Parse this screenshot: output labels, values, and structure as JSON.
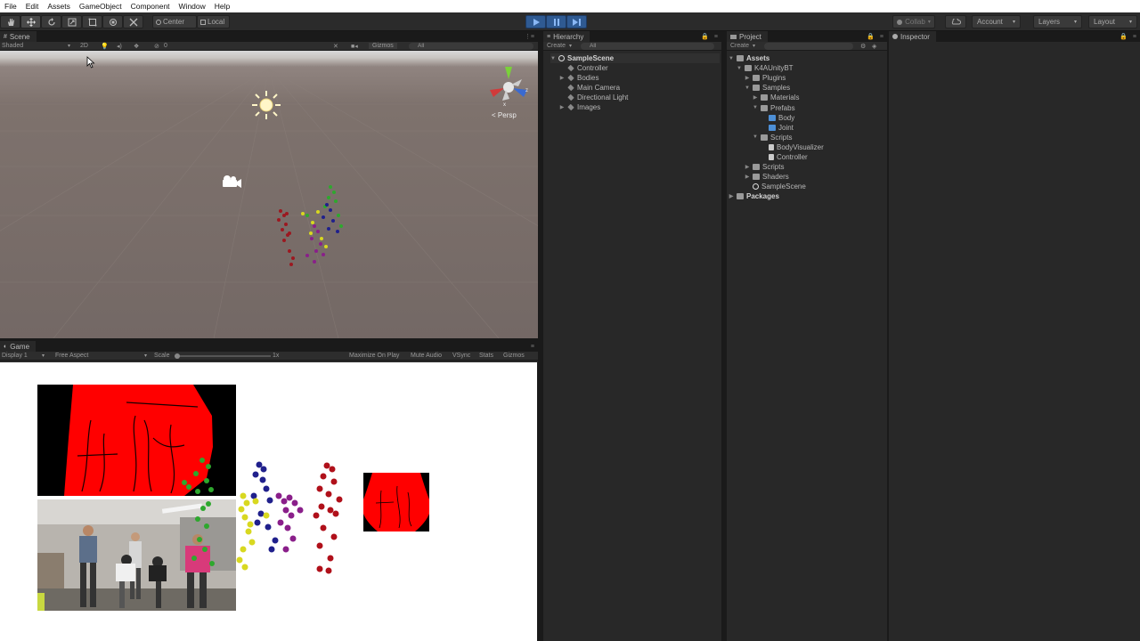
{
  "menu": [
    "File",
    "Edit",
    "Assets",
    "GameObject",
    "Component",
    "Window",
    "Help"
  ],
  "toolbar": {
    "tools": [
      "hand-icon",
      "move-icon",
      "rotate-icon",
      "scale-icon",
      "rect-icon",
      "transform-icon",
      "custom-icon"
    ],
    "pivot": "Center",
    "space": "Local",
    "collab": "Collab",
    "account": "Account",
    "layers": "Layers",
    "layout": "Layout"
  },
  "scene": {
    "tab": "Scene",
    "shading": "Shaded",
    "mode2d": "2D",
    "gizmos": "Gizmos",
    "search": "All",
    "hidden_count": "0",
    "persp": "Persp"
  },
  "game": {
    "tab": "Game",
    "display": "Display 1",
    "aspect": "Free Aspect",
    "scale_label": "Scale",
    "scale_value": "1x",
    "toggles": [
      "Maximize On Play",
      "Mute Audio",
      "VSync",
      "Stats",
      "Gizmos"
    ]
  },
  "hierarchy": {
    "tab": "Hierarchy",
    "create": "Create",
    "search": "All",
    "scene": "SampleScene",
    "items": [
      {
        "label": "Controller",
        "expandable": false
      },
      {
        "label": "Bodies",
        "expandable": true
      },
      {
        "label": "Main Camera",
        "expandable": false
      },
      {
        "label": "Directional Light",
        "expandable": false
      },
      {
        "label": "Images",
        "expandable": true
      }
    ]
  },
  "project": {
    "tab": "Project",
    "create": "Create",
    "items": [
      {
        "label": "Assets",
        "type": "folder",
        "indent": 0,
        "arrow": "down",
        "bold": true
      },
      {
        "label": "K4AUnityBT",
        "type": "folder",
        "indent": 1,
        "arrow": "down"
      },
      {
        "label": "Plugins",
        "type": "folder",
        "indent": 2,
        "arrow": "right"
      },
      {
        "label": "Samples",
        "type": "folder",
        "indent": 2,
        "arrow": "down"
      },
      {
        "label": "Materials",
        "type": "folder",
        "indent": 3,
        "arrow": "right"
      },
      {
        "label": "Prefabs",
        "type": "folder",
        "indent": 3,
        "arrow": "down"
      },
      {
        "label": "Body",
        "type": "prefab",
        "indent": 4,
        "arrow": ""
      },
      {
        "label": "Joint",
        "type": "prefab",
        "indent": 4,
        "arrow": ""
      },
      {
        "label": "Scripts",
        "type": "folder",
        "indent": 3,
        "arrow": "down"
      },
      {
        "label": "BodyVisualizer",
        "type": "script",
        "indent": 4,
        "arrow": ""
      },
      {
        "label": "Controller",
        "type": "script",
        "indent": 4,
        "arrow": ""
      },
      {
        "label": "Scripts",
        "type": "folder",
        "indent": 2,
        "arrow": "right"
      },
      {
        "label": "Shaders",
        "type": "folder",
        "indent": 2,
        "arrow": "right"
      },
      {
        "label": "SampleScene",
        "type": "unity",
        "indent": 2,
        "arrow": ""
      },
      {
        "label": "Packages",
        "type": "folder",
        "indent": 0,
        "arrow": "right",
        "bold": true
      }
    ]
  },
  "inspector": {
    "tab": "Inspector"
  },
  "colors": {
    "play_accent": "#2f5a92",
    "depth_red": "#ff0000",
    "joint_red": "#b0101a",
    "joint_green": "#2ea82e",
    "joint_blue": "#20208c",
    "joint_yellow": "#d8d820",
    "joint_purple": "#8a1f8a"
  }
}
